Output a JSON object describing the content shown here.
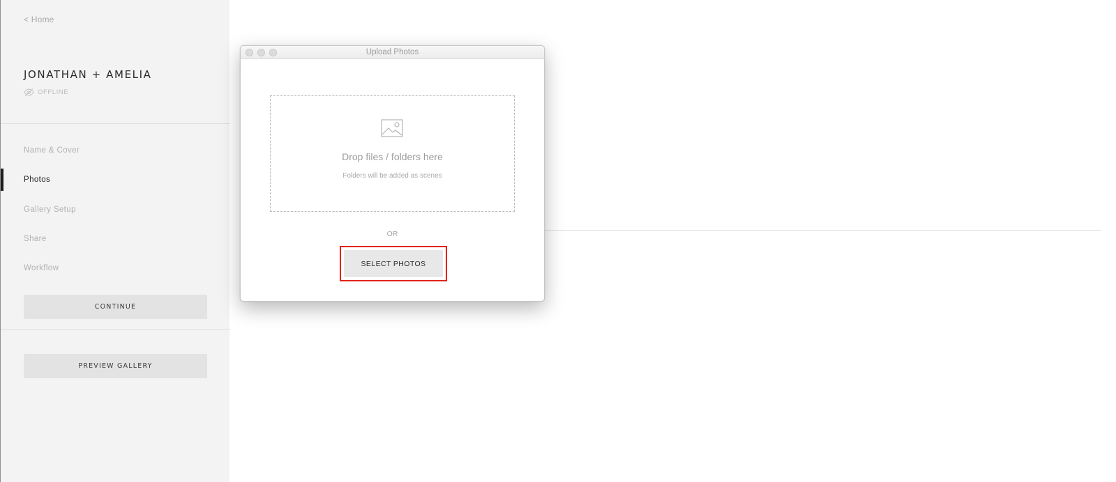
{
  "sidebar": {
    "home_link": "< Home",
    "gallery_title": "JONATHAN + AMELIA",
    "status": "OFFLINE",
    "nav_items": [
      {
        "label": "Name & Cover",
        "active": false
      },
      {
        "label": "Photos",
        "active": true
      },
      {
        "label": "Gallery Setup",
        "active": false
      },
      {
        "label": "Share",
        "active": false
      },
      {
        "label": "Workflow",
        "active": false
      }
    ],
    "continue_label": "CONTINUE",
    "preview_label": "PREVIEW GALLERY"
  },
  "dialog": {
    "title": "Upload Photos",
    "drop_heading": "Drop files / folders here",
    "drop_sub": "Folders will be added as scenes",
    "or_text": "OR",
    "select_label": "SELECT PHOTOS",
    "highlight_color": "#e2231a"
  },
  "icons": {
    "status": "eye-slash-icon",
    "dropzone": "image-icon"
  }
}
